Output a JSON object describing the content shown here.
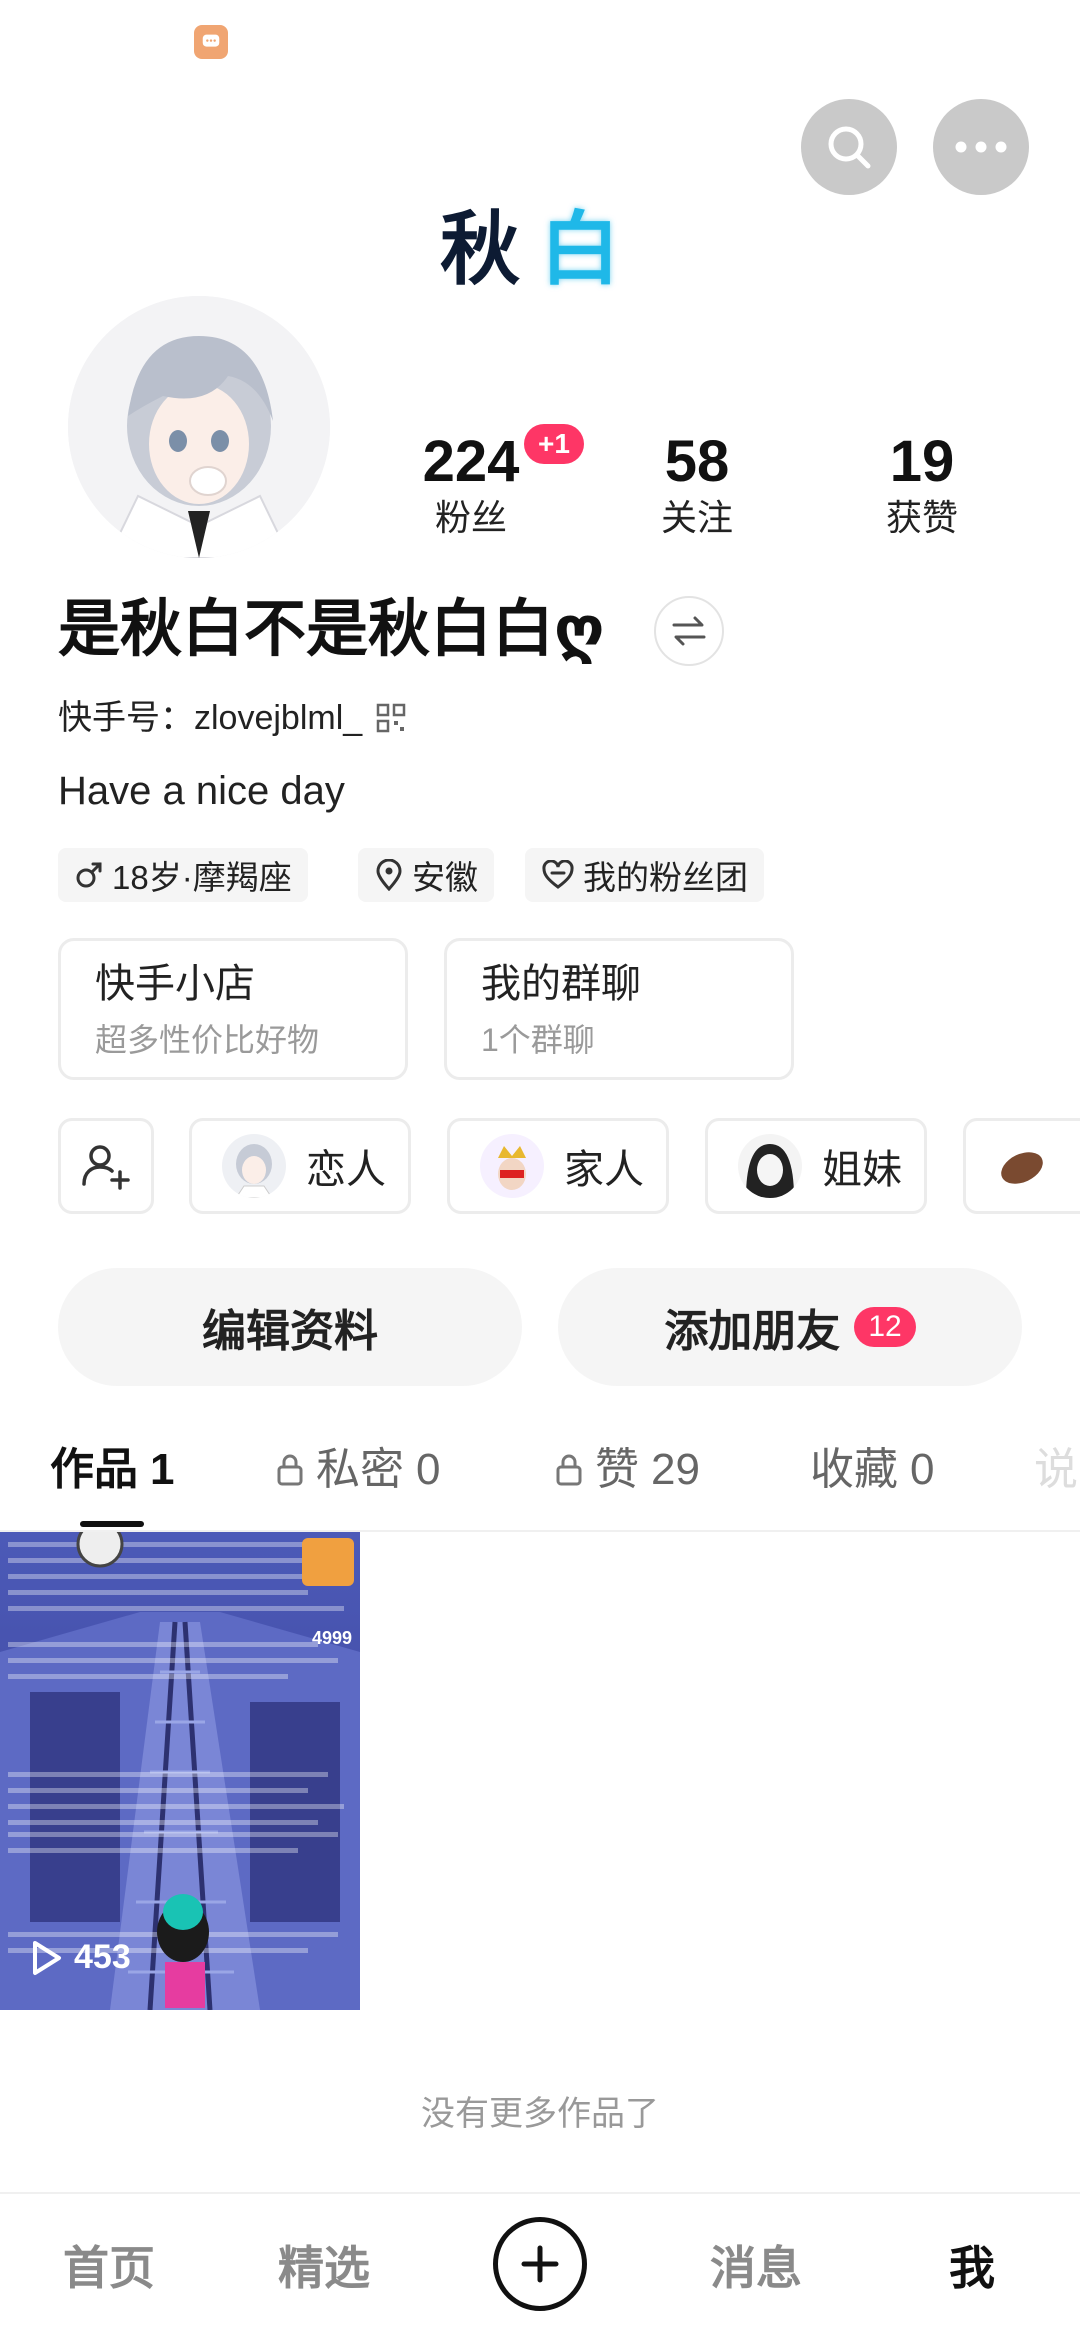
{
  "decorative_title": {
    "left": "秋",
    "right": "白"
  },
  "stats": [
    {
      "value": "224",
      "label": "粉丝",
      "badge": "+1"
    },
    {
      "value": "58",
      "label": "关注"
    },
    {
      "value": "19",
      "label": "获赞"
    }
  ],
  "profile": {
    "nickname": "是秋白不是秋白白ღ",
    "kuaishou_id_label": "快手号：",
    "kuaishou_id": "zlovejblml_",
    "bio": "Have a nice day"
  },
  "tags": [
    "18岁·摩羯座",
    "安徽",
    "我的粉丝团"
  ],
  "cards": [
    {
      "title": "快手小店",
      "subtitle": "超多性价比好物"
    },
    {
      "title": "我的群聊",
      "subtitle": "1个群聊"
    }
  ],
  "relations": [
    "恋人",
    "家人",
    "姐妹"
  ],
  "actions": {
    "edit": "编辑资料",
    "add_friend": "添加朋友",
    "add_friend_badge": "12"
  },
  "tabs": [
    {
      "label": "作品",
      "count": "1"
    },
    {
      "label": "私密",
      "count": "0"
    },
    {
      "label": "赞",
      "count": "29"
    },
    {
      "label": "收藏",
      "count": "0"
    },
    {
      "label": "说"
    }
  ],
  "video": {
    "play_count": "453",
    "corner_badge": "4999"
  },
  "footer_text": "没有更多作品了",
  "bottom_nav": [
    "首页",
    "精选",
    "消息",
    "我"
  ],
  "colors": {
    "accent": "#fe3666",
    "chip_bg": "#f5f5f5"
  },
  "icons": [
    "message-icon",
    "search-icon",
    "more-icon",
    "switch-icon",
    "qrcode-icon",
    "male-icon",
    "location-icon",
    "heart-icon",
    "add-friend-icon",
    "lock-icon",
    "play-icon",
    "plus-icon"
  ]
}
